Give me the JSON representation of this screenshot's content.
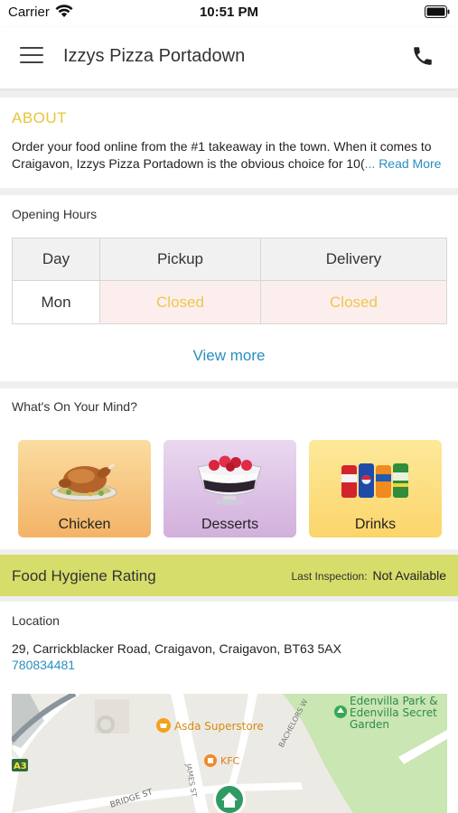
{
  "status_bar": {
    "carrier": "Carrier",
    "time": "10:51 PM"
  },
  "header": {
    "title": "Izzys Pizza Portadown"
  },
  "about": {
    "heading": "ABOUT",
    "text": "Order your food online from the #1 takeaway in the town. When it comes to Craigavon, Izzys Pizza Portadown is the obvious choice for 10(",
    "read_more": "... Read More"
  },
  "opening_hours": {
    "heading": "Opening Hours",
    "columns": [
      "Day",
      "Pickup",
      "Delivery"
    ],
    "rows": [
      {
        "day": "Mon",
        "pickup": "Closed",
        "delivery": "Closed"
      }
    ],
    "view_more": "View more"
  },
  "whats_on_your_mind": {
    "heading": "What's On Your Mind?",
    "categories": [
      {
        "label": "Chicken",
        "icon": "roast-chicken-icon"
      },
      {
        "label": "Desserts",
        "icon": "dessert-bowl-icon"
      },
      {
        "label": "Drinks",
        "icon": "soda-cans-icon"
      }
    ]
  },
  "hygiene": {
    "label": "Food Hygiene Rating",
    "last_inspection_label": "Last Inspection:",
    "last_inspection_value": "Not Available"
  },
  "location": {
    "heading": "Location",
    "address": "29, Carrickblacker Road, Craigavon, Craigavon, BT63 5AX",
    "phone": "780834481",
    "map": {
      "labels": {
        "asda": "Asda Superstore",
        "kfc": "KFC",
        "park": "Edenvilla Park &",
        "park2": "Edenvilla Secret",
        "park3": "Garden",
        "road_a3": "A3",
        "bachelors": "BACHELORS W",
        "james": "JAMES ST",
        "bridge": "BRIDGE ST"
      }
    }
  },
  "colors": {
    "accent_link": "#2a8fbf",
    "about_heading": "#e8c53a",
    "hygiene_bar": "#d7dd6a",
    "closed_bg": "#fdeeee"
  }
}
